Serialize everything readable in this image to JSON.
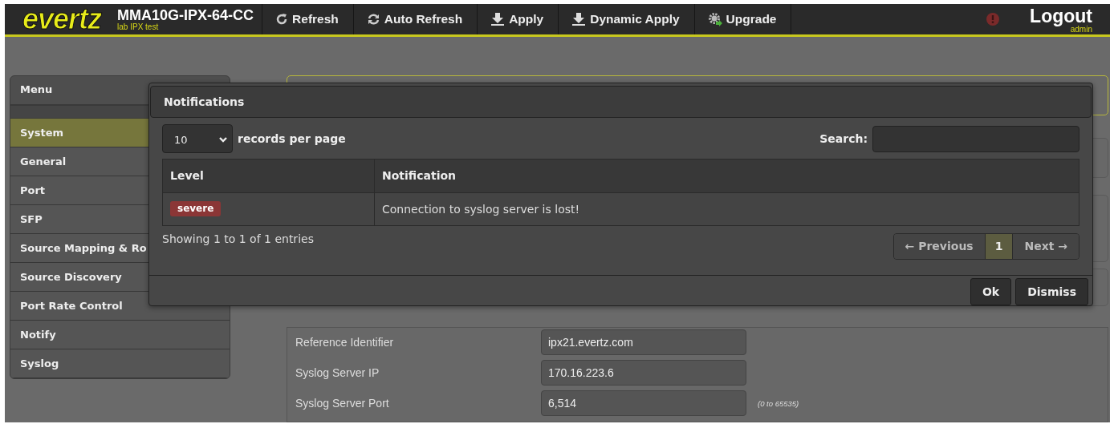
{
  "header": {
    "logo": "evertz",
    "device": "MMA10G-IPX-64-CC",
    "location": "lab IPX test",
    "toolbar": [
      {
        "label": "Refresh",
        "kind": "refresh"
      },
      {
        "label": "Auto Refresh",
        "kind": "sync"
      },
      {
        "label": "Apply",
        "kind": "download"
      },
      {
        "label": "Dynamic Apply",
        "kind": "download"
      },
      {
        "label": "Upgrade",
        "kind": "gear"
      }
    ],
    "logout": "Logout",
    "user": "admin"
  },
  "sidebar": {
    "title": "Menu",
    "items": [
      {
        "label": "System",
        "selected": true
      },
      {
        "label": "General",
        "selected": false
      },
      {
        "label": "Port",
        "selected": false
      },
      {
        "label": "SFP",
        "selected": false
      },
      {
        "label": "Source Mapping & Ro",
        "selected": false
      },
      {
        "label": "Source Discovery",
        "selected": false
      },
      {
        "label": "Port Rate Control",
        "selected": false
      },
      {
        "label": "Notify",
        "selected": false
      },
      {
        "label": "Syslog",
        "selected": false
      }
    ]
  },
  "form": {
    "fields": [
      {
        "label": "Reference Identifier",
        "value": "ipx21.evertz.com"
      },
      {
        "label": "Syslog Server IP",
        "value": "170.16.223.6"
      },
      {
        "label": "Syslog Server Port",
        "value": "6,514",
        "hint": "(0 to 65535)"
      }
    ]
  },
  "modal": {
    "title": "Notifications",
    "page_size": "10",
    "page_size_label": "records per page",
    "search_label": "Search:",
    "columns": [
      "Level",
      "Notification"
    ],
    "rows": [
      {
        "level": "severe",
        "color": "#8b3636",
        "notification": "Connection to syslog server is lost!"
      }
    ],
    "info": "Showing 1 to 1 of 1 entries",
    "pagination": {
      "previous": "← Previous",
      "pages": [
        {
          "label": "1",
          "selected": true
        }
      ],
      "next": "Next →"
    },
    "buttons": [
      "Ok",
      "Dismiss"
    ]
  }
}
